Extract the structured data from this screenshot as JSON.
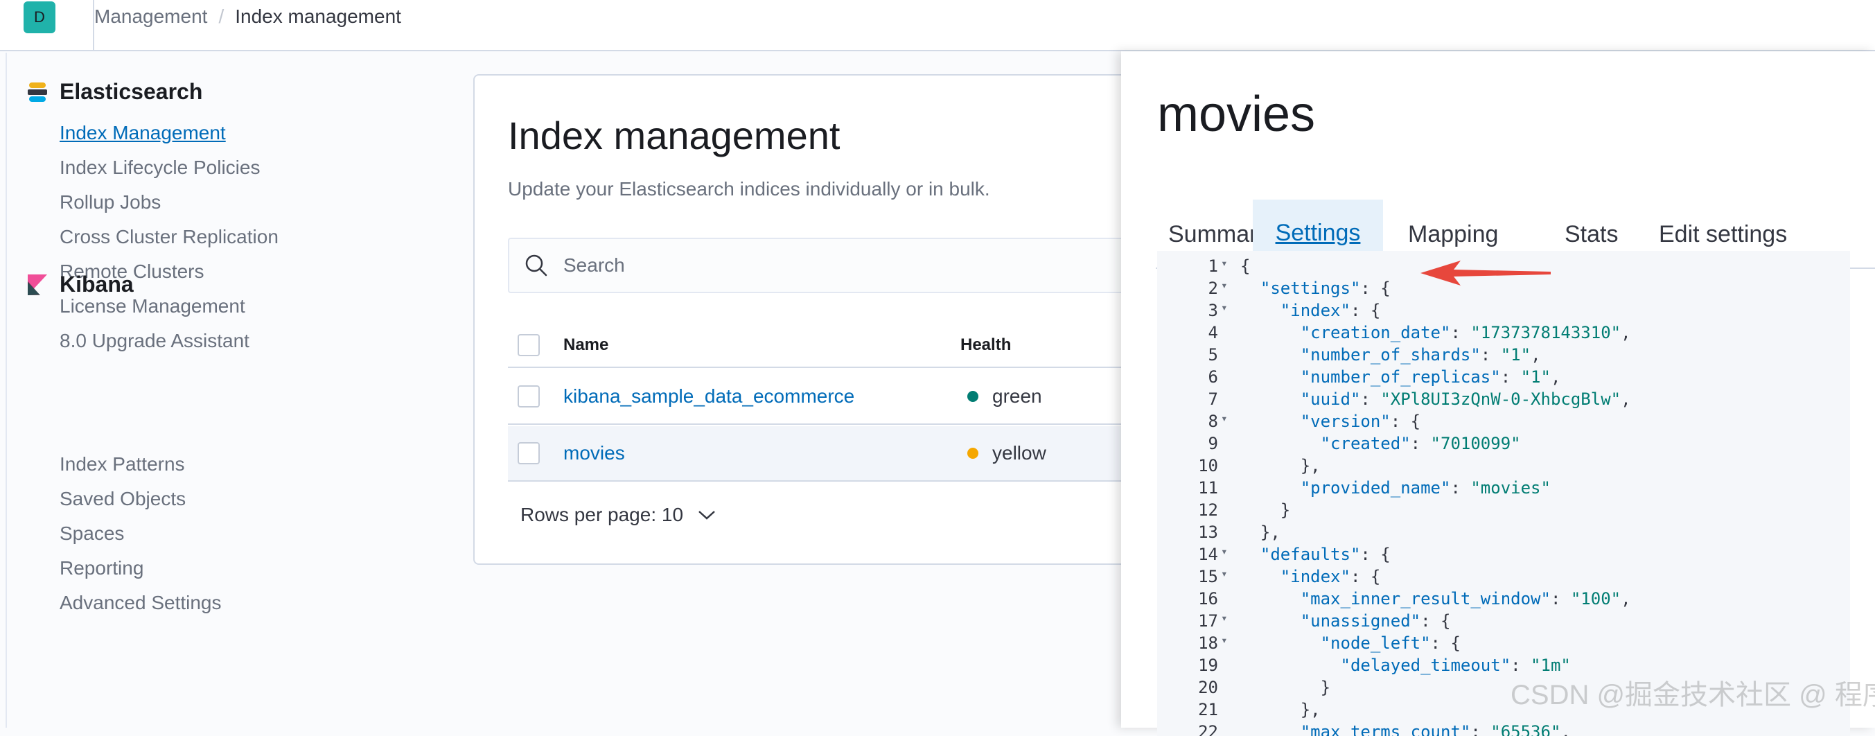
{
  "header": {
    "avatar": "D",
    "breadcrumb_parent": "Management",
    "breadcrumb_current": "Index management"
  },
  "sidebar": {
    "elasticsearch": {
      "title": "Elasticsearch",
      "items": [
        "Index Management",
        "Index Lifecycle Policies",
        "Rollup Jobs",
        "Cross Cluster Replication",
        "Remote Clusters",
        "License Management",
        "8.0 Upgrade Assistant"
      ],
      "active_index": 0
    },
    "kibana": {
      "title": "Kibana",
      "items": [
        "Index Patterns",
        "Saved Objects",
        "Spaces",
        "Reporting",
        "Advanced Settings"
      ]
    }
  },
  "main": {
    "title": "Index management",
    "description": "Update your Elasticsearch indices individually or in bulk.",
    "search_placeholder": "Search",
    "table": {
      "columns": [
        "Name",
        "Health"
      ],
      "rows": [
        {
          "name": "kibana_sample_data_ecommerce",
          "health": "green"
        },
        {
          "name": "movies",
          "health": "yellow"
        }
      ]
    },
    "rows_per_page": "Rows per page: 10"
  },
  "flyout": {
    "title": "movies",
    "tabs": [
      "Summary",
      "Settings",
      "Mapping",
      "Stats",
      "Edit settings"
    ],
    "selected_tab": "Settings",
    "code_lines": [
      "{",
      "  \"settings\": {",
      "    \"index\": {",
      "      \"creation_date\": \"1737378143310\",",
      "      \"number_of_shards\": \"1\",",
      "      \"number_of_replicas\": \"1\",",
      "      \"uuid\": \"XPl8UI3zQnW-0-XhbcgBlw\",",
      "      \"version\": {",
      "        \"created\": \"7010099\"",
      "      },",
      "      \"provided_name\": \"movies\"",
      "    }",
      "  },",
      "  \"defaults\": {",
      "    \"index\": {",
      "      \"max_inner_result_window\": \"100\",",
      "      \"unassigned\": {",
      "        \"node_left\": {",
      "          \"delayed_timeout\": \"1m\"",
      "        }",
      "      },",
      "      \"max_terms_count\": \"65536\","
    ],
    "fold_lines": [
      1,
      2,
      3,
      8,
      14,
      15,
      17,
      18
    ]
  },
  "colors": {
    "accent": "#006bb8",
    "health_green": "#017d73",
    "health_yellow": "#f5a700",
    "json_key": "#006bb8",
    "json_string": "#017d73",
    "annotation_arrow": "#e7473c"
  },
  "watermark": "CSDN @掘金技术社区 @ 程序员麻辣烫"
}
